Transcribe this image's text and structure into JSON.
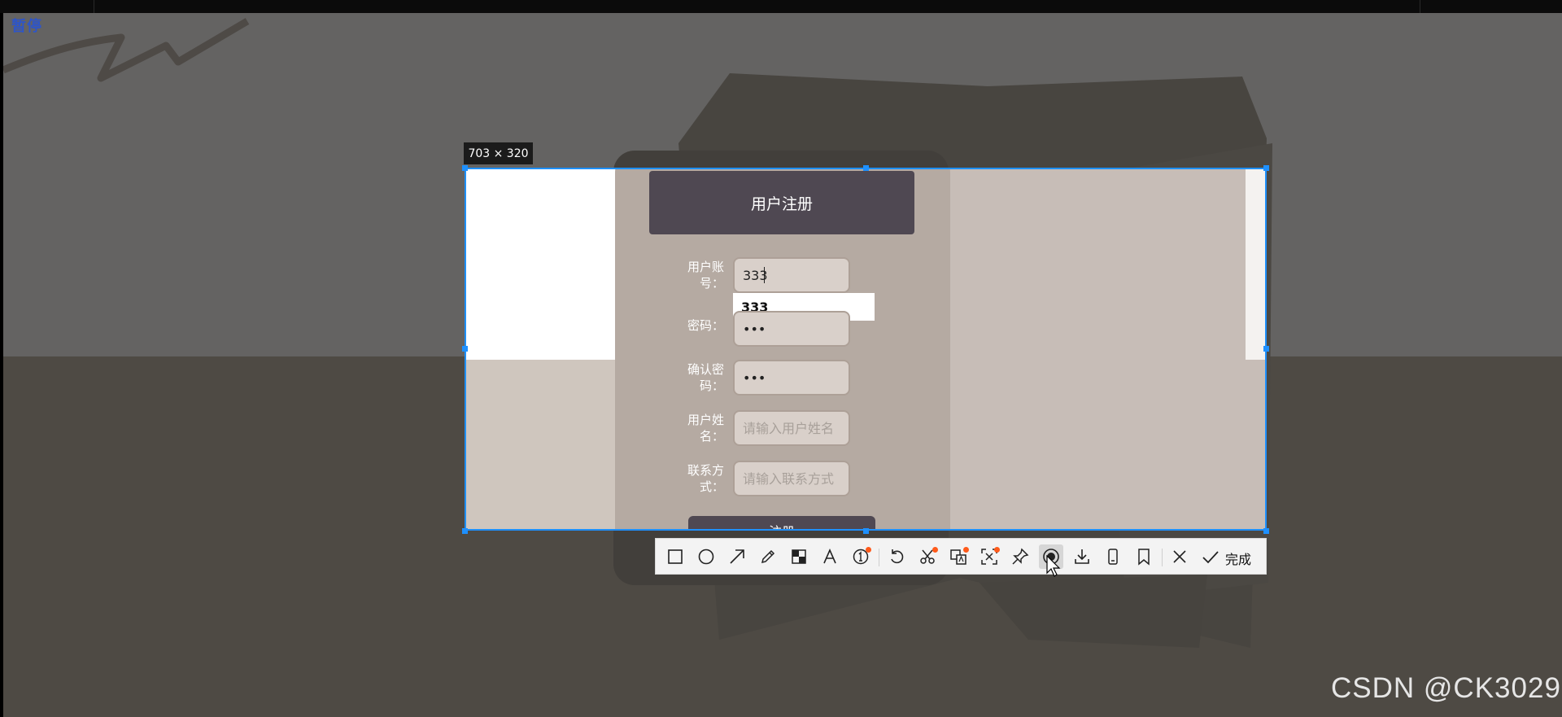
{
  "status": {
    "paused_label": "暂停"
  },
  "selection": {
    "size_label": "703 × 320"
  },
  "form": {
    "title": "用户注册",
    "fields": [
      {
        "label": "用户账号：",
        "value": "333",
        "placeholder": ""
      },
      {
        "label": "密码：",
        "value": "•••",
        "placeholder": ""
      },
      {
        "label": "确认密码：",
        "value": "•••",
        "placeholder": ""
      },
      {
        "label": "用户姓名：",
        "value": "",
        "placeholder": "请输入用户姓名"
      },
      {
        "label": "联系方式：",
        "value": "",
        "placeholder": "请输入联系方式"
      }
    ],
    "autocomplete_option": "333",
    "submit_label": "注册"
  },
  "toolbar": {
    "tools": [
      "rectangle-icon",
      "circle-icon",
      "arrow-icon",
      "pencil-icon",
      "mosaic-icon",
      "text-icon",
      "number-marker-icon",
      "undo-icon",
      "scissors-icon",
      "translate-icon",
      "ocr-icon",
      "pin-icon",
      "record-icon",
      "download-icon",
      "phone-icon",
      "bookmark-icon",
      "close-icon",
      "check-icon"
    ],
    "done_label": "完成"
  },
  "watermark": "CSDN @CK3029",
  "colors": {
    "selection_border": "#1e90ff",
    "header_bg": "#4f4852",
    "badge_dot": "#ff5a1a"
  }
}
